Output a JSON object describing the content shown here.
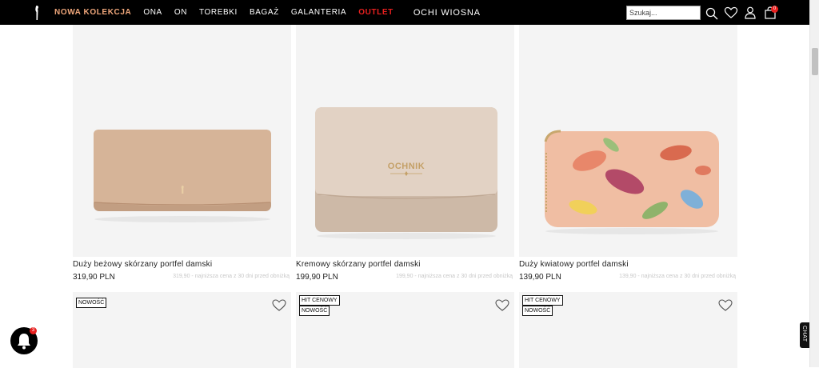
{
  "header": {
    "logo_icon": "figure-logo-icon",
    "nav": [
      {
        "label": "NOWA KOLEKCJA"
      },
      {
        "label": "ONA"
      },
      {
        "label": "ON"
      },
      {
        "label": "TOREBKI"
      },
      {
        "label": "BAGAŻ"
      },
      {
        "label": "GALANTERIA"
      },
      {
        "label": "OUTLET"
      },
      {
        "label": "OCHI WIOSNA"
      }
    ],
    "search_placeholder": "Szukaj...",
    "cart_count": "0",
    "colors": {
      "accent": "#f0a77b",
      "outlet": "#e8201f",
      "bar": "#000000"
    }
  },
  "products": [
    {
      "name": "Duży beżowy skórzany portfel damski",
      "price": "319,90 PLN",
      "lowest": "319,90 - najniższa cena z 30 dni przed obniżką"
    },
    {
      "name": "Kremowy skórzany portfel damski",
      "price": "199,90 PLN",
      "lowest": "199,90 - najniższa cena z 30 dni przed obniżką"
    },
    {
      "name": "Duży kwiatowy portfel damski",
      "price": "139,90 PLN",
      "lowest": "139,90 - najniższa cena z 30 dni przed obniżką"
    }
  ],
  "row2": [
    {
      "badges": [
        "NOWOŚĆ"
      ]
    },
    {
      "badges": [
        "HIT CENOWY",
        "NOWOŚĆ"
      ]
    },
    {
      "badges": [
        "HIT CENOWY",
        "NOWOŚĆ"
      ]
    }
  ],
  "brand_text": "OCHNIK",
  "chat": {
    "label": "CHAT",
    "notification_count": "3"
  }
}
